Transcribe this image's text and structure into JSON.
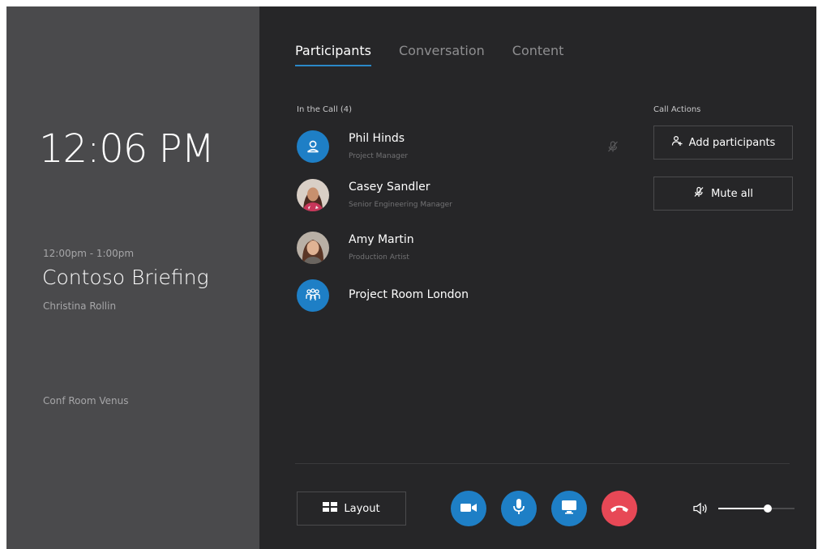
{
  "colors": {
    "left_panel": "#4a4a4c",
    "main_panel": "#262628",
    "accent_blue": "#1e7fc6",
    "hangup_red": "#e74856",
    "tab_underline": "#2b88c8"
  },
  "sidebar": {
    "clock": "12:06 PM",
    "meeting_time": "12:00pm - 1:00pm",
    "meeting_title": "Contoso Briefing",
    "organizer": "Christina Rollin",
    "room": "Conf Room Venus"
  },
  "tabs": [
    {
      "label": "Participants",
      "active": true
    },
    {
      "label": "Conversation",
      "active": false
    },
    {
      "label": "Content",
      "active": false
    }
  ],
  "participants": {
    "header": "In the Call (4)",
    "list": [
      {
        "name": "Phil Hinds",
        "role": "Project Manager",
        "avatar": "person-icon",
        "muted": true
      },
      {
        "name": "Casey Sandler",
        "role": "Senior Engineering Manager",
        "avatar": "photo"
      },
      {
        "name": "Amy Martin",
        "role": "Production Artist",
        "avatar": "photo"
      },
      {
        "name": "Project Room London",
        "role": "",
        "avatar": "group-icon"
      }
    ]
  },
  "call_actions": {
    "header": "Call Actions",
    "add_participants": "Add participants",
    "mute_all": "Mute all"
  },
  "controls": {
    "layout_label": "Layout",
    "buttons": [
      "video-icon",
      "microphone-icon",
      "screen-share-icon",
      "hang-up-icon"
    ],
    "volume_level": 0.65
  }
}
